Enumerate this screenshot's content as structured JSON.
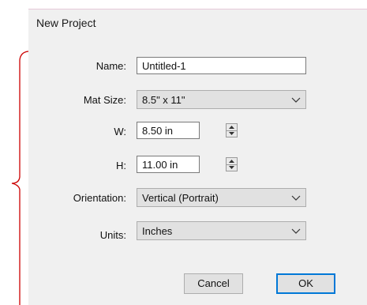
{
  "dialog": {
    "title": "New Project",
    "name_label": "Name:",
    "name_value": "Untitled-1",
    "mat_label": "Mat Size:",
    "mat_value": "8.5\" x 11\"",
    "w_label": "W:",
    "w_value": "8.50 in",
    "h_label": "H:",
    "h_value": "11.00 in",
    "orientation_label": "Orientation:",
    "orientation_value": "Vertical (Portrait)",
    "units_label": "Units:",
    "units_value": "Inches",
    "cancel_label": "Cancel",
    "ok_label": "OK"
  },
  "colors": {
    "annotation": "#cc0000",
    "dialog_bg": "#f0f0f0",
    "ok_border": "#0078d7"
  },
  "icons": {
    "dropdown": "chevron-down-icon",
    "spin_up": "arrow-up-icon",
    "spin_down": "arrow-down-icon"
  }
}
